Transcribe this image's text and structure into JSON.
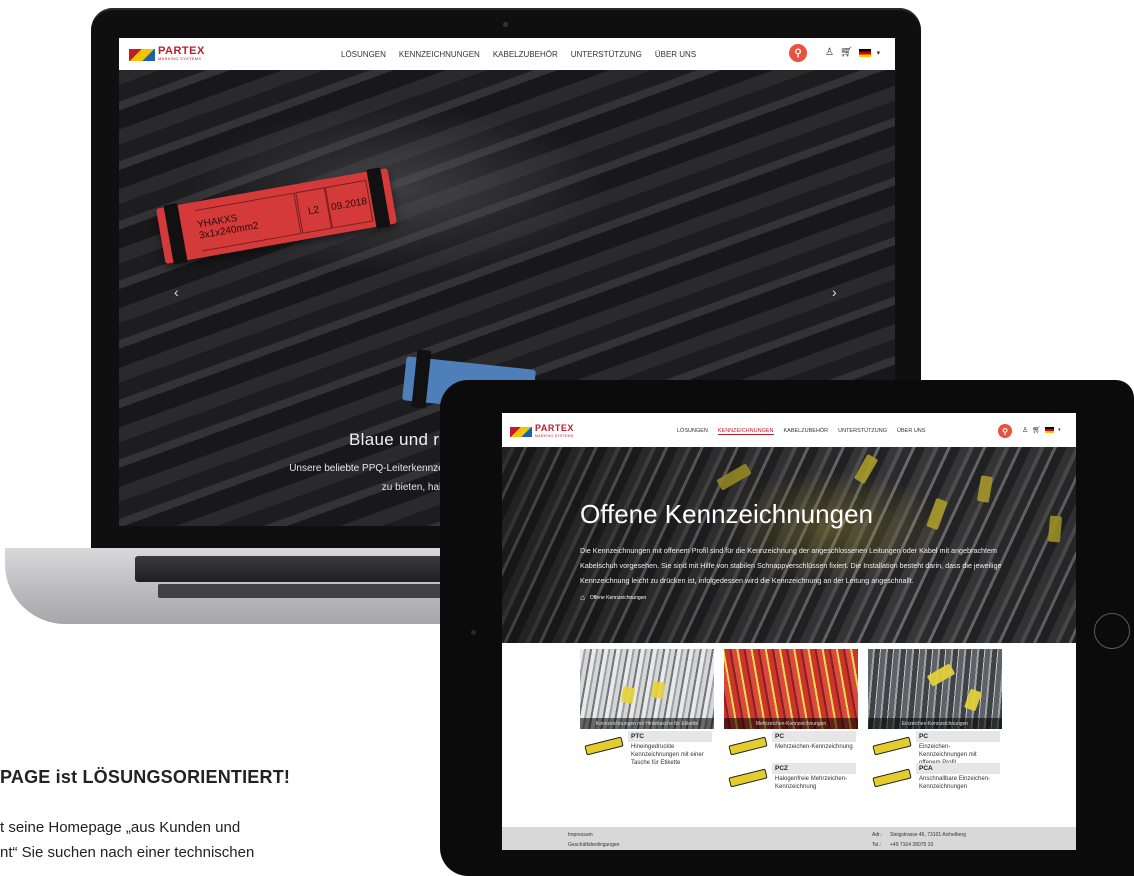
{
  "brand": {
    "name": "PARTEX",
    "tagline": "MARKING SYSTEMS",
    "accent": "#e8533e",
    "red": "#c01c2c"
  },
  "nav": {
    "items": [
      "LÖSUNGEN",
      "KENNZEICHNUNGEN",
      "KABELZUBEHÖR",
      "UNTERSTÜTZUNG",
      "ÜBER UNS"
    ],
    "icons": [
      "search-icon",
      "user-icon",
      "cart-icon",
      "flag-de-icon",
      "chevron-down-icon"
    ]
  },
  "laptop": {
    "tag_text": "YHAKXS 3x1x240mm2",
    "tag_cell_1": "L2",
    "tag_cell_2": "09.2018",
    "hero_title": "Blaue und ro",
    "hero_text_1": "Unsere beliebte PPQ-Leiterkennzeichnung ist ber",
    "hero_text_2": "zu bieten, haben wir in unse",
    "prev_arrow": "‹",
    "next_arrow": "›"
  },
  "tablet": {
    "hero_title": "Offene Kennzeichnungen",
    "hero_text": "Die Kennzeichnungen mit offenem Profil sind für die Kennzeichnung der angeschlossenen Leitungen oder Kabel mit angebrachtem Kabelschuh vorgesehen. Sie sind mit Hilfe von stabilen Schnappverschlüssen fixiert. Die Installation besteht darin, dass die jeweilige Kennzeichnung leicht zu drücken ist, infolgedessen wird die Kennzeichnung an der Leitung angeschnallt.",
    "breadcrumb": "Offene Kennzeichnungen",
    "cards": [
      {
        "caption": "Kennzeichnungen mit Hinteltasche für Etikette",
        "products": [
          {
            "code": "PTC",
            "desc": "Hineingedruckte Kennzeichnungen mit einer Tasche für Etikette"
          }
        ]
      },
      {
        "caption": "Mehrzeichen-Kennzeichnungen",
        "products": [
          {
            "code": "PC",
            "desc": "Mehrzeichen-Kennzeichnung"
          },
          {
            "code": "PCZ",
            "desc": "Halogenfreie Mehrzeichen-Kennzeichnung"
          }
        ]
      },
      {
        "caption": "Einzeichen-Kennzeichnungen",
        "products": [
          {
            "code": "PC",
            "desc": "Einzeichen-Kennzeichnungen mit offenem Profil"
          },
          {
            "code": "PCA",
            "desc": "Anschnallbare Einzeichen-Kennzeichnungen"
          }
        ]
      }
    ],
    "footer": {
      "left_1": "Impressum",
      "left_2": "Geschäftsbedingungen",
      "addr_label": "Adr.:",
      "addr": "Steigstrasse 46, 73101 Aichelberg",
      "tel_label": "Tel.:",
      "tel": "+49 7164 28075 10"
    }
  },
  "page": {
    "headline": "PAGE ist LÖSUNGSORIENTIERT!",
    "body_1": "t seine Homepage „aus Kunden und",
    "body_2": "nt“ Sie suchen nach einer technischen"
  }
}
